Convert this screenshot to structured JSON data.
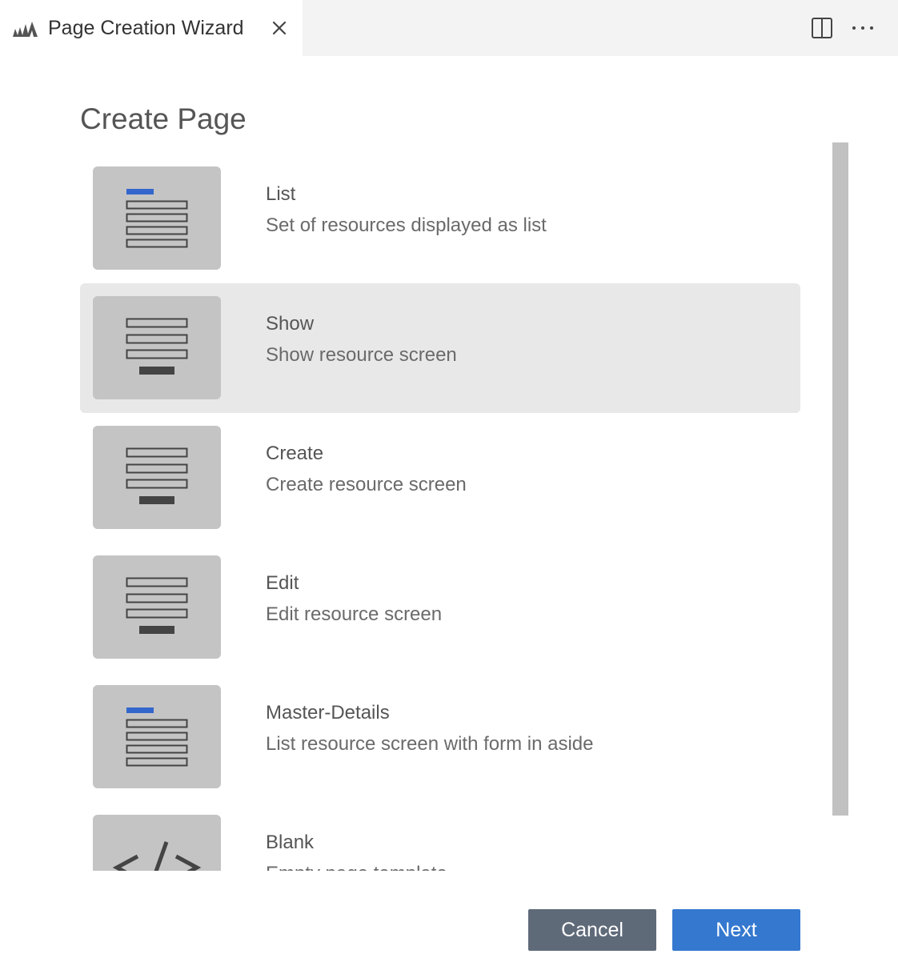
{
  "tab": {
    "title": "Page Creation Wizard",
    "icon": "logo-icon"
  },
  "toolbar": {
    "split_icon": "split-editor-icon",
    "more_icon": "more-actions-icon"
  },
  "page": {
    "title": "Create Page"
  },
  "templates": [
    {
      "title": "List",
      "description": "Set of resources displayed as list",
      "icon": "list-template-icon",
      "selected": false
    },
    {
      "title": "Show",
      "description": "Show resource screen",
      "icon": "form-template-icon",
      "selected": true
    },
    {
      "title": "Create",
      "description": "Create resource screen",
      "icon": "form-template-icon",
      "selected": false
    },
    {
      "title": "Edit",
      "description": "Edit resource screen",
      "icon": "form-template-icon",
      "selected": false
    },
    {
      "title": "Master-Details",
      "description": "List resource screen with form in aside",
      "icon": "list-template-icon",
      "selected": false
    },
    {
      "title": "Blank",
      "description": "Empty page template",
      "icon": "code-icon",
      "selected": false
    }
  ],
  "buttons": {
    "cancel": "Cancel",
    "next": "Next"
  },
  "colors": {
    "accent": "#3478cf",
    "list_marker": "#3366cc",
    "selected_bg": "#e8e8e8",
    "thumb_bg": "#c4c4c4",
    "cancel_bg": "#5f6a79"
  }
}
